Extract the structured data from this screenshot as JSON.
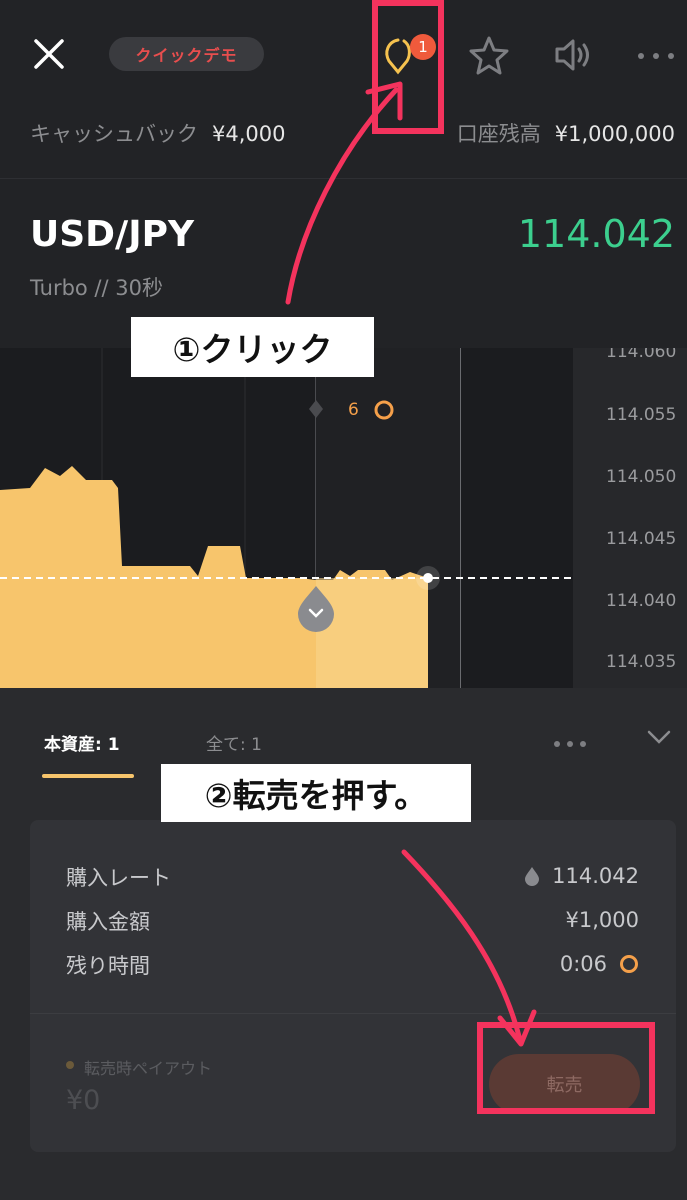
{
  "header": {
    "mode_label": "クイックデモ",
    "notification_count": "1",
    "cashback_label": "キャッシュバック",
    "cashback_value": "¥4,000",
    "balance_label": "口座残高",
    "balance_value": "¥1,000,000"
  },
  "asset": {
    "pair": "USD/JPY",
    "price": "114.042",
    "price_color": "#3ccf8e",
    "sub": "Turbo  //  30秒"
  },
  "chart": {
    "marker_count": "6",
    "y_ticks": [
      "114.060",
      "114.055",
      "114.050",
      "114.045",
      "114.040",
      "114.035"
    ],
    "fill_color": "#f7c56c"
  },
  "tabs": {
    "active": "本資産: 1",
    "all": "全て: 1"
  },
  "position": {
    "rate_label": "購入レート",
    "rate_value": "114.042",
    "amount_label": "購入金額",
    "amount_value": "¥1,000",
    "remaining_label": "残り時間",
    "remaining_value": "0:06",
    "payout_label": "転売時ペイアウト",
    "payout_value": "¥0",
    "resell_label": "転売"
  },
  "annotations": {
    "step1": "①クリック",
    "step2": "②転売を押す。",
    "highlight_color": "#f4335d"
  }
}
